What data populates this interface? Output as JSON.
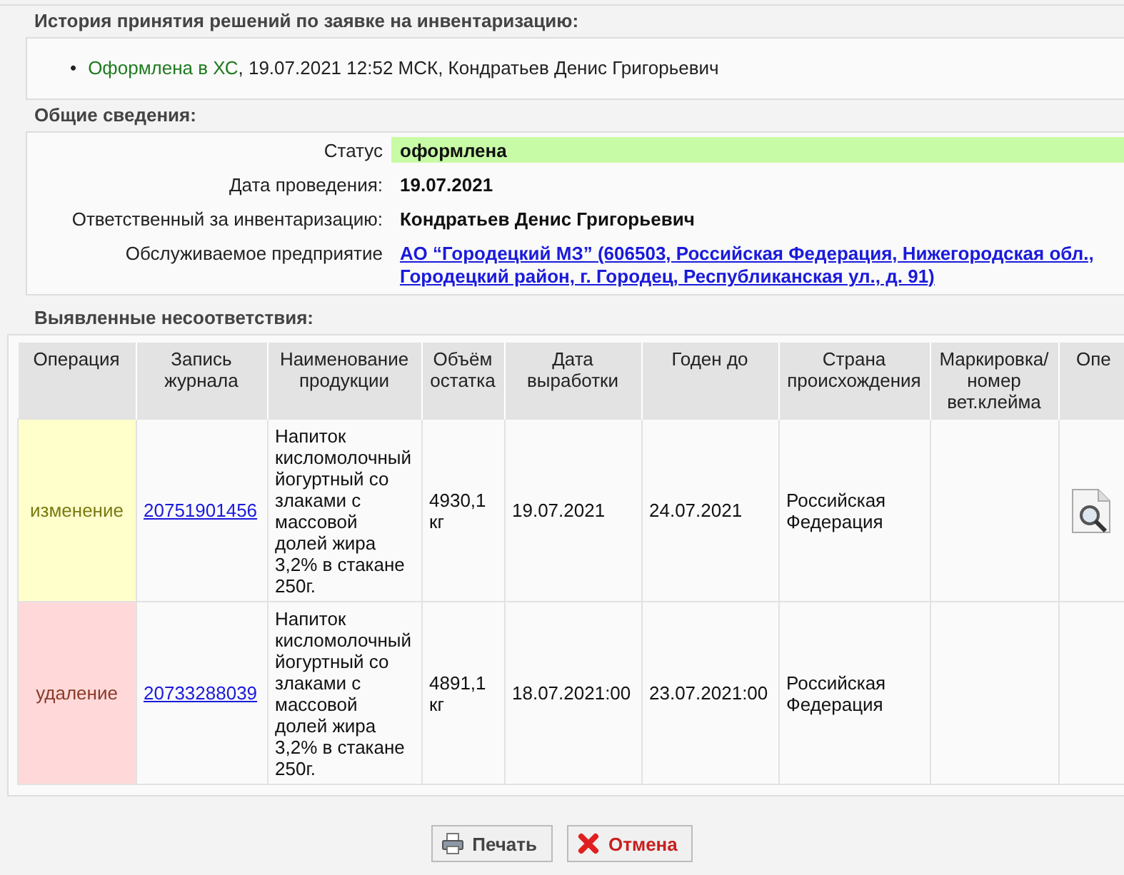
{
  "history": {
    "title": "История принятия решений по заявке на инвентаризацию:",
    "entries": [
      {
        "marker": "•",
        "status": "Оформлена в ХС",
        "details": ", 19.07.2021 12:52 МСК, Кондратьев Денис Григорьевич"
      }
    ]
  },
  "general": {
    "title": "Общие сведения:",
    "fields": [
      {
        "label": "Статус",
        "value": "оформлена",
        "kind": "status"
      },
      {
        "label": "Дата проведения:",
        "value": "19.07.2021",
        "kind": "text"
      },
      {
        "label": "Ответственный за инвентаризацию:",
        "value": "Кондратьев Денис Григорьевич",
        "kind": "text"
      },
      {
        "label": "Обслуживаемое предприятие",
        "value": "АО “Городецкий МЗ” (606503, Российская Федерация, Нижегородская обл., Городецкий район, г. Городец, Республиканская ул., д. 91)",
        "kind": "link"
      }
    ]
  },
  "discrepancies": {
    "title": "Выявленные несоответствия:",
    "columns": [
      "Операция",
      "Запись журнала",
      "Наименование продукции",
      "Объём остатка",
      "Дата выработки",
      "Годен до",
      "Страна происхождения",
      "Маркировка/ номер вет.клейма",
      "Опе"
    ],
    "rows": [
      {
        "operation": "изменение",
        "kind": "change",
        "record": "20751901456",
        "product": "Напиток кисломолочный йогуртный со злаками с массовой долей жира 3,2% в стакане 250г.",
        "volume": "4930,1 кг",
        "produced": "19.07.2021",
        "expires": "24.07.2021",
        "country": "Российская Федерация",
        "viewable": true
      },
      {
        "operation": "удаление",
        "kind": "delete",
        "record": "20733288039",
        "product": "Напиток кисломолочный йогуртный со злаками с массовой долей жира 3,2% в стакане 250г.",
        "volume": "4891,1 кг",
        "produced": "18.07.2021:00",
        "expires": "23.07.2021:00",
        "country": "Российская Федерация",
        "viewable": false
      }
    ]
  },
  "buttons": [
    {
      "label": "Печать",
      "kind": "print"
    },
    {
      "label": "Отмена",
      "kind": "cancel"
    }
  ]
}
